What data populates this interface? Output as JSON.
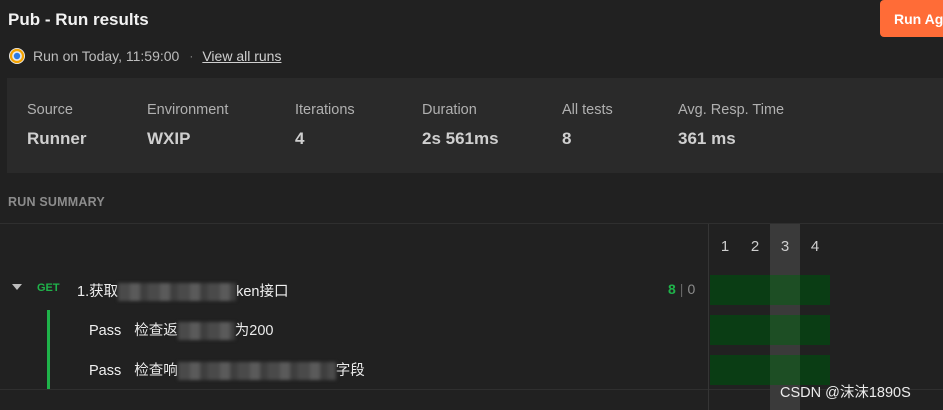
{
  "header": {
    "title": "Pub - Run results",
    "run_again_label": "Run Ag",
    "run_info_text": "Run on Today, 11:59:00",
    "separator": "·",
    "view_all_runs_label": "View all runs"
  },
  "stats": [
    {
      "label": "Source",
      "value": "Runner"
    },
    {
      "label": "Environment",
      "value": "WXIP"
    },
    {
      "label": "Iterations",
      "value": "4"
    },
    {
      "label": "Duration",
      "value": "2s 561ms"
    },
    {
      "label": "All tests",
      "value": "8"
    },
    {
      "label": "Avg. Resp. Time",
      "value": "361 ms"
    }
  ],
  "summary": {
    "header": "RUN SUMMARY",
    "iterations": [
      "1",
      "2",
      "3",
      "4"
    ],
    "request": {
      "method": "GET",
      "name_prefix": "1.获取",
      "name_suffix": "ken接口",
      "pass_count": "8",
      "count_separator": "|",
      "fail_count": "0"
    },
    "tests": [
      {
        "status": "Pass",
        "name_prefix": "检查返",
        "name_suffix": "为200"
      },
      {
        "status": "Pass",
        "name_prefix": "检查响",
        "name_suffix": "字段"
      }
    ]
  },
  "colors": {
    "accent": "#ff6c37",
    "pass": "#1fb34a",
    "result_cell": "#0a3d14"
  },
  "watermark": "CSDN @沫沫1890S"
}
